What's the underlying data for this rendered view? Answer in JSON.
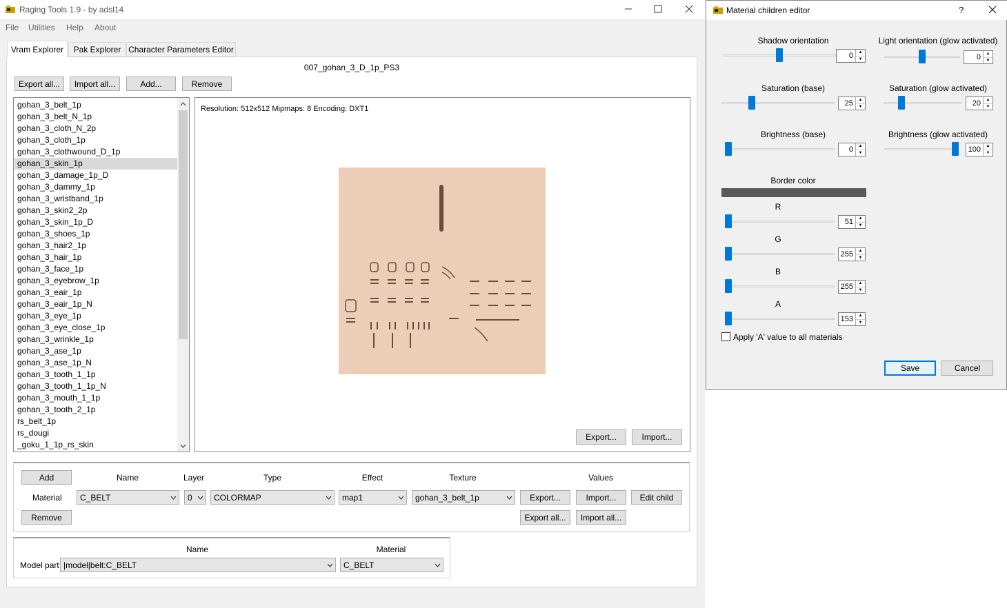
{
  "window": {
    "title": "Raging Tools 1.9 - by adsl14",
    "menu": [
      "File",
      "Utilities",
      "Help",
      "About"
    ]
  },
  "tabs": [
    "Vram Explorer",
    "Pak Explorer",
    "Character Parameters Editor"
  ],
  "file_title": "007_gohan_3_D_1p_PS3",
  "toolbar": {
    "export_all": "Export all...",
    "import_all": "Import all...",
    "add": "Add...",
    "remove": "Remove"
  },
  "texture_list": {
    "items": [
      "gohan_3_belt_1p",
      "gohan_3_belt_N_1p",
      "gohan_3_cloth_N_2p",
      "gohan_3_cloth_1p",
      "gohan_3_clothwound_D_1p",
      "gohan_3_skin_1p",
      "gohan_3_damage_1p_D",
      "gohan_3_dammy_1p",
      "gohan_3_wristband_1p",
      "gohan_3_skin2_2p",
      "gohan_3_skin_1p_D",
      "gohan_3_shoes_1p",
      "gohan_3_hair2_1p",
      "gohan_3_hair_1p",
      "gohan_3_face_1p",
      "gohan_3_eyebrow_1p",
      "gohan_3_eair_1p",
      "gohan_3_eair_1p_N",
      "gohan_3_eye_1p",
      "gohan_3_eye_close_1p",
      "gohan_3_wrinkle_1p",
      "gohan_3_ase_1p",
      "gohan_3_ase_1p_N",
      "gohan_3_tooth_1_1p",
      "gohan_3_tooth_1_1p_N",
      "gohan_3_mouth_1_1p",
      "gohan_3_tooth_2_1p",
      "rs_belt_1p",
      "rs_dougi",
      "_goku_1_1p_rs_skin"
    ],
    "selected": "gohan_3_skin_1p"
  },
  "preview": {
    "info": "Resolution: 512x512  Mipmaps: 8  Encoding: DXT1",
    "export": "Export...",
    "import": "Import...",
    "texture_color": "#ebcdb8"
  },
  "material_section": {
    "add": "Add",
    "remove": "Remove",
    "row_label": "Material",
    "headers": {
      "name": "Name",
      "layer": "Layer",
      "type": "Type",
      "effect": "Effect",
      "texture": "Texture",
      "values": "Values"
    },
    "name": "C_BELT",
    "layer": "0",
    "type": "COLORMAP",
    "effect": "map1",
    "texture": "gohan_3_belt_1p",
    "export": "Export...",
    "import": "Import...",
    "edit_child": "Edit child",
    "export_all": "Export all...",
    "import_all": "Import all..."
  },
  "model_section": {
    "headers": {
      "name": "Name",
      "material": "Material"
    },
    "row_label": "Model part",
    "name": "|model|belt:C_BELT",
    "material": "C_BELT"
  },
  "dialog": {
    "title": "Material children editor",
    "help": "?",
    "shadow_orientation": {
      "label": "Shadow orientation",
      "value": "0",
      "level": 0.5
    },
    "light_orientation": {
      "label": "Light orientation (glow activated)",
      "value": "0",
      "level": 0.5
    },
    "saturation_base": {
      "label": "Saturation (base)",
      "value": "25",
      "level": 0.25
    },
    "saturation_glow": {
      "label": "Saturation (glow activated)",
      "value": "20",
      "level": 0.2
    },
    "brightness_base": {
      "label": "Brightness (base)",
      "value": "0",
      "level": 0.0
    },
    "brightness_glow": {
      "label": "Brightness (glow activated)",
      "value": "100",
      "level": 1.0
    },
    "border_color": {
      "label": "Border color",
      "swatch": "#595959"
    },
    "r": {
      "label": "R",
      "value": "51",
      "level": 0.0
    },
    "g": {
      "label": "G",
      "value": "255",
      "level": 0.0
    },
    "b": {
      "label": "B",
      "value": "255",
      "level": 0.0
    },
    "a": {
      "label": "A",
      "value": "153",
      "level": 0.0
    },
    "apply_a": "Apply 'A' value to all materials",
    "save": "Save",
    "cancel": "Cancel"
  }
}
